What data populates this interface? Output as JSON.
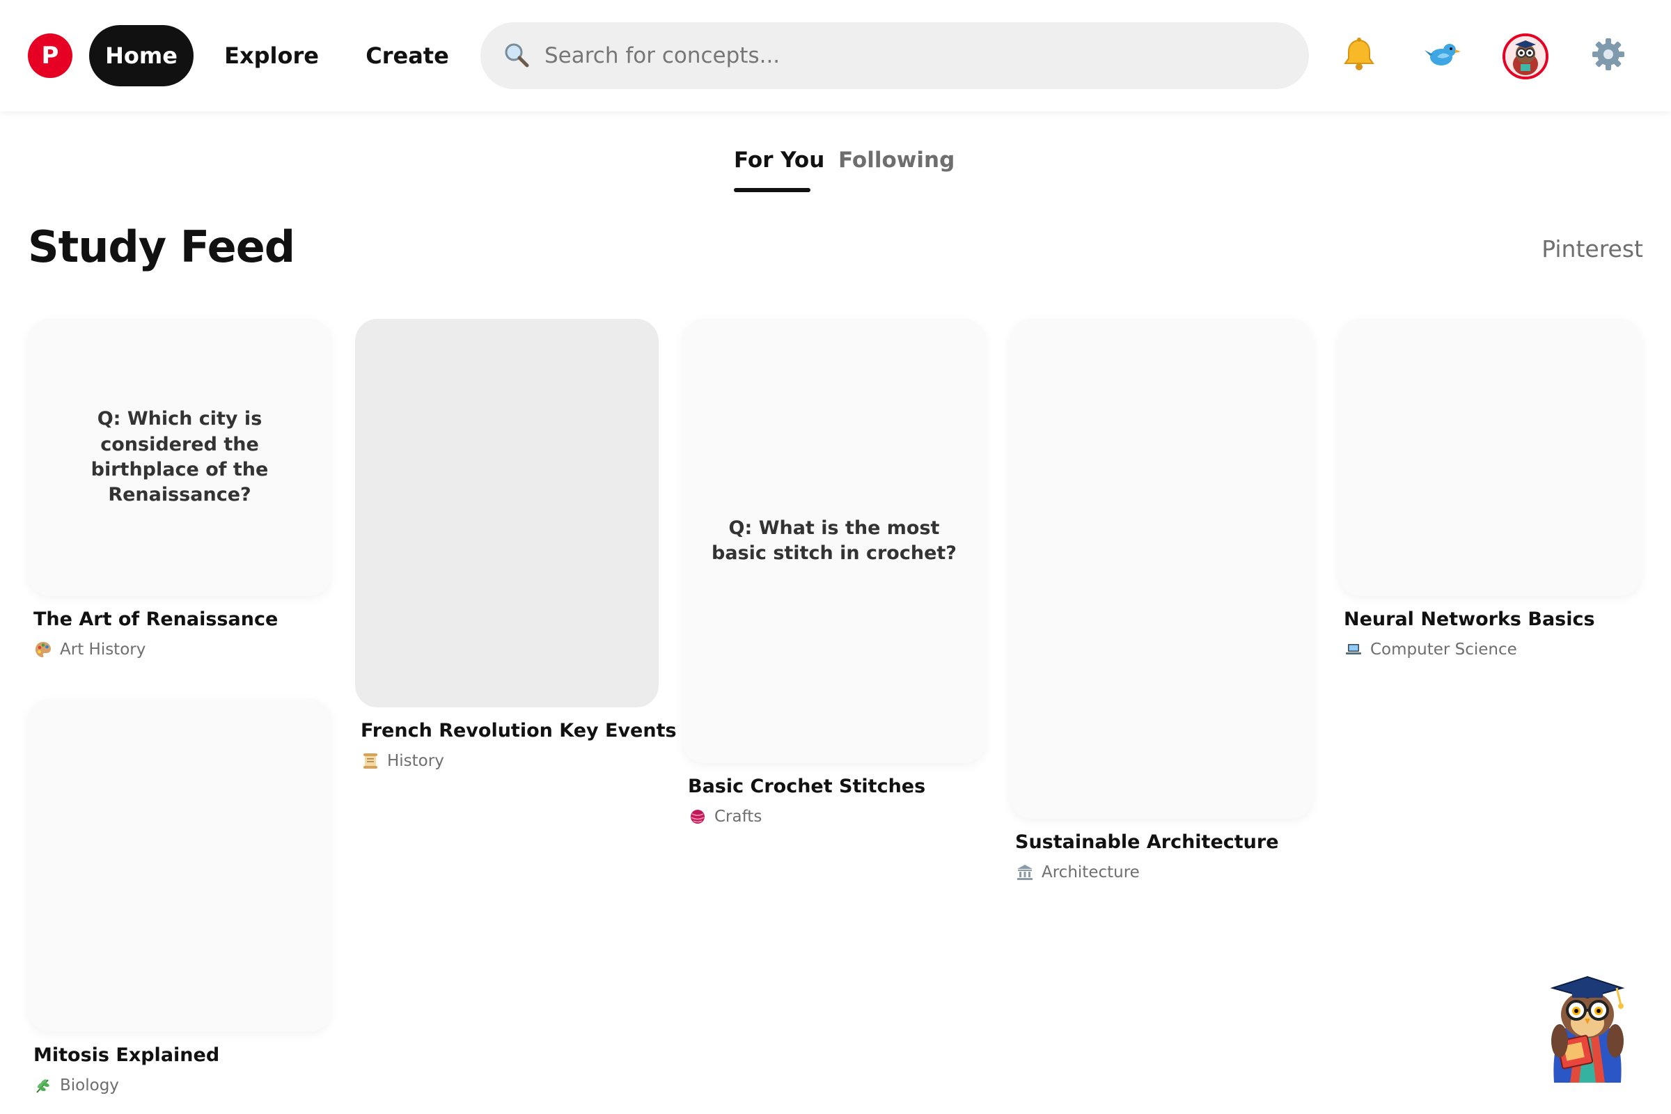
{
  "header": {
    "logo_letter": "P",
    "nav": [
      {
        "label": "Home",
        "active": true
      },
      {
        "label": "Explore",
        "active": false
      },
      {
        "label": "Create",
        "active": false
      }
    ],
    "search": {
      "placeholder": "Search for concepts...",
      "value": "",
      "icon": "search-icon"
    },
    "icons": [
      "bell-icon",
      "bird-icon",
      "avatar",
      "gear-icon"
    ]
  },
  "tabs": [
    {
      "label": "For You",
      "active": true
    },
    {
      "label": "Following",
      "active": false
    }
  ],
  "page": {
    "title": "Study Feed",
    "brand": "Pinterest"
  },
  "pins": [
    {
      "title": "The Art of Renaissance",
      "category": "Art History",
      "category_icon": "palette-icon",
      "question": "Q: Which city is considered the birthplace of the Renaissance?"
    },
    {
      "title": "French Revolution Key Events",
      "category": "History",
      "category_icon": "scroll-icon",
      "question": ""
    },
    {
      "title": "Basic Crochet Stitches",
      "category": "Crafts",
      "category_icon": "yarn-icon",
      "question": "Q: What is the most basic stitch in crochet?"
    },
    {
      "title": "Sustainable Architecture",
      "category": "Architecture",
      "category_icon": "classical-building-icon",
      "question": ""
    },
    {
      "title": "Neural Networks Basics",
      "category": "Computer Science",
      "category_icon": "laptop-icon",
      "question": ""
    },
    {
      "title": "Mitosis Explained",
      "category": "Biology",
      "category_icon": "herb-icon",
      "question": ""
    }
  ],
  "mascot": {
    "icon": "owl-scholar-icon"
  },
  "colors": {
    "brand": "#e60023",
    "active_nav": "#111111",
    "search_bg": "#efefef",
    "card_bg": "#fafafa",
    "muted_text": "#6e6e6e"
  }
}
